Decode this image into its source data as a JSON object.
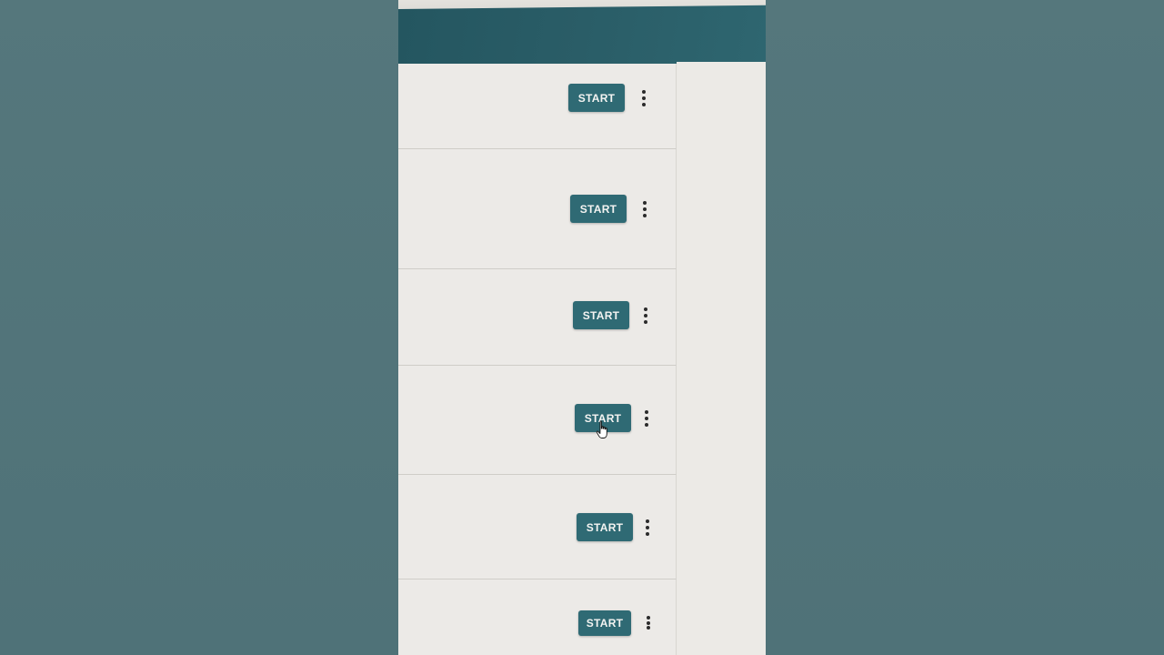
{
  "rows": [
    {
      "action_label": "START"
    },
    {
      "action_label": "START"
    },
    {
      "action_label": "START"
    },
    {
      "action_label": "START"
    },
    {
      "action_label": "START"
    },
    {
      "action_label": "START"
    }
  ],
  "icons": {
    "more": "more-vertical-icon",
    "cursor": "hand-pointer-icon"
  },
  "colors": {
    "header": "#2a5d67",
    "button": "#2f6a74",
    "background": "#527479"
  }
}
